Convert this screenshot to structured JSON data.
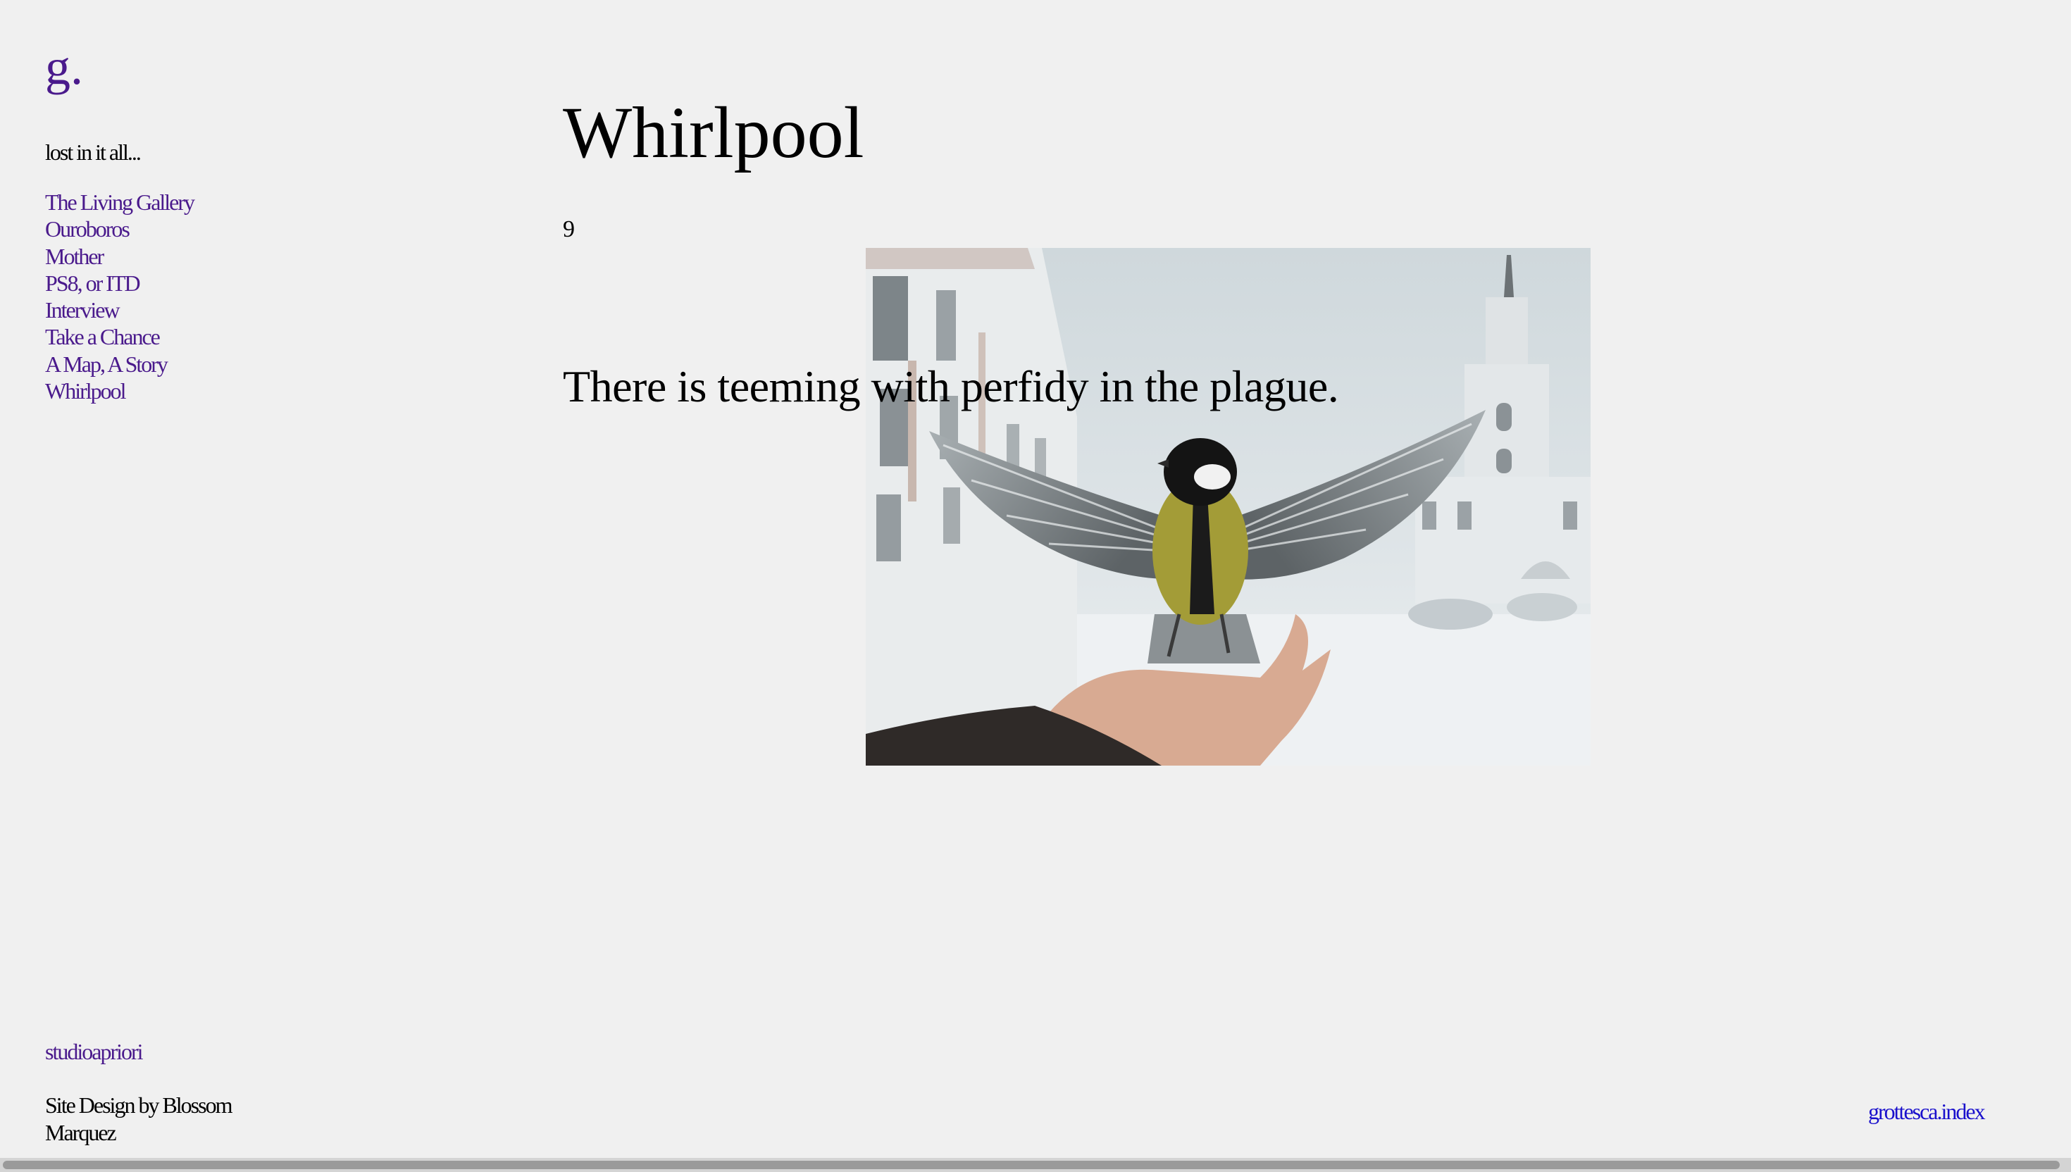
{
  "site": {
    "logo": "g.",
    "tagline": "lost in it all..."
  },
  "nav": {
    "items": [
      {
        "label": "The Living Gallery"
      },
      {
        "label": "Ouroboros"
      },
      {
        "label": "Mother"
      },
      {
        "label": "PS8, or ITD"
      },
      {
        "label": "Interview"
      },
      {
        "label": "Take a Chance"
      },
      {
        "label": "A Map, A Story"
      },
      {
        "label": "Whirlpool"
      }
    ]
  },
  "main": {
    "title": "Whirlpool",
    "entry_number": "9",
    "quote": "There is teeming with perfidy in the plague."
  },
  "footer": {
    "studio_link": "studioapriori",
    "credit": "Site Design by Blossom Marquez",
    "index_link": "grottesca.index"
  },
  "colors": {
    "background": "#f0f0f0",
    "nav_link": "#4a1a8c",
    "index_link": "#1a10cc"
  }
}
